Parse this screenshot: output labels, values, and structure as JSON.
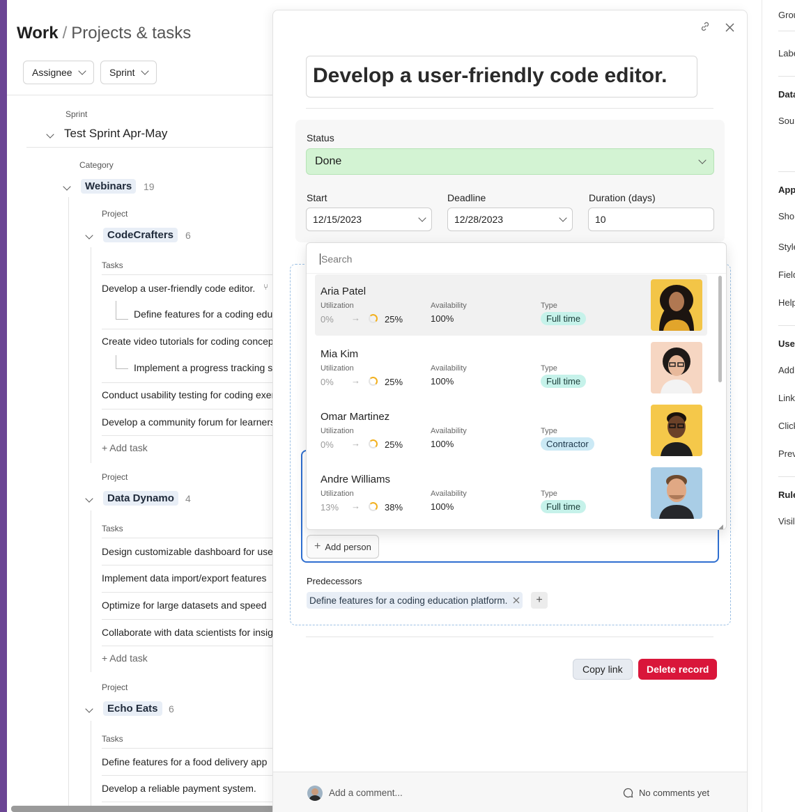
{
  "header": {
    "title": "Work",
    "separator": "/",
    "subtitle": "Projects & tasks"
  },
  "filters": [
    {
      "label": "Assignee"
    },
    {
      "label": "Sprint"
    }
  ],
  "sprint": {
    "label": "Sprint",
    "name": "Test Sprint Apr-May"
  },
  "category": {
    "label": "Category",
    "name": "Webinars",
    "count": "19"
  },
  "projects": [
    {
      "label": "Project",
      "name": "CodeCrafters",
      "count": "6",
      "tasks_label": "Tasks",
      "tasks": [
        "Develop a user-friendly code editor.",
        "Define features for a coding educ",
        "Create video tutorials for coding concept",
        "Implement a progress tracking sy",
        "Conduct usability testing for coding exer",
        "Develop a community forum for learners."
      ],
      "add_task": "Add task"
    },
    {
      "label": "Project",
      "name": "Data Dynamo",
      "count": "4",
      "tasks_label": "Tasks",
      "tasks": [
        "Design customizable dashboard for users",
        "Implement data import/export features",
        "Optimize for large datasets and speed",
        "Collaborate with data scientists for insigh"
      ],
      "add_task": "Add task"
    },
    {
      "label": "Project",
      "name": "Echo Eats",
      "count": "6",
      "tasks_label": "Tasks",
      "tasks": [
        "Define features for a food delivery app",
        "Develop a reliable payment system."
      ]
    }
  ],
  "right_sidebar": {
    "items": [
      "Grou",
      "Labe"
    ],
    "sections": [
      {
        "title": "Data",
        "items": [
          "Sou"
        ]
      },
      {
        "title": "App",
        "items": [
          "Sho",
          "Style",
          "Field",
          "Help"
        ]
      },
      {
        "title": "Use",
        "items": [
          "Add",
          "Link",
          "Click",
          "Prev"
        ]
      },
      {
        "title": "Rule",
        "items": [
          "Visil"
        ]
      }
    ]
  },
  "record": {
    "title": "Develop a user-friendly code editor.",
    "status_label": "Status",
    "status_value": "Done",
    "status_color": "#d3f3d3",
    "start_label": "Start",
    "start_value": "12/15/2023",
    "deadline_label": "Deadline",
    "deadline_value": "12/28/2023",
    "duration_label": "Duration (days)",
    "duration_value": "10",
    "add_person": "Add person",
    "predecessors_label": "Predecessors",
    "predecessor": "Define features for a coding education platform.",
    "copy_link": "Copy link",
    "delete_record": "Delete record",
    "comment_placeholder": "Add a comment...",
    "no_comments": "No comments yet"
  },
  "dropdown": {
    "search_placeholder": "Search",
    "people": [
      {
        "name": "Aria Patel",
        "utilization_label": "Utilization",
        "util_from": "0%",
        "util_to": "25%",
        "availability_label": "Availability",
        "availability": "100%",
        "type_label": "Type",
        "type": "Full time",
        "selected": true
      },
      {
        "name": "Mia Kim",
        "utilization_label": "Utilization",
        "util_from": "0%",
        "util_to": "25%",
        "availability_label": "Availability",
        "availability": "100%",
        "type_label": "Type",
        "type": "Full time"
      },
      {
        "name": "Omar Martinez",
        "utilization_label": "Utilization",
        "util_from": "0%",
        "util_to": "25%",
        "availability_label": "Availability",
        "availability": "100%",
        "type_label": "Type",
        "type": "Contractor"
      },
      {
        "name": "Andre Williams",
        "utilization_label": "Utilization",
        "util_from": "13%",
        "util_to": "38%",
        "availability_label": "Availability",
        "availability": "100%",
        "type_label": "Type",
        "type": "Full time"
      }
    ]
  },
  "colors": {
    "accent_purple": "#6b4594",
    "delete_red": "#d9163a",
    "focus_blue": "#2f6fd0",
    "badge_teal": "#c6f2ea"
  }
}
